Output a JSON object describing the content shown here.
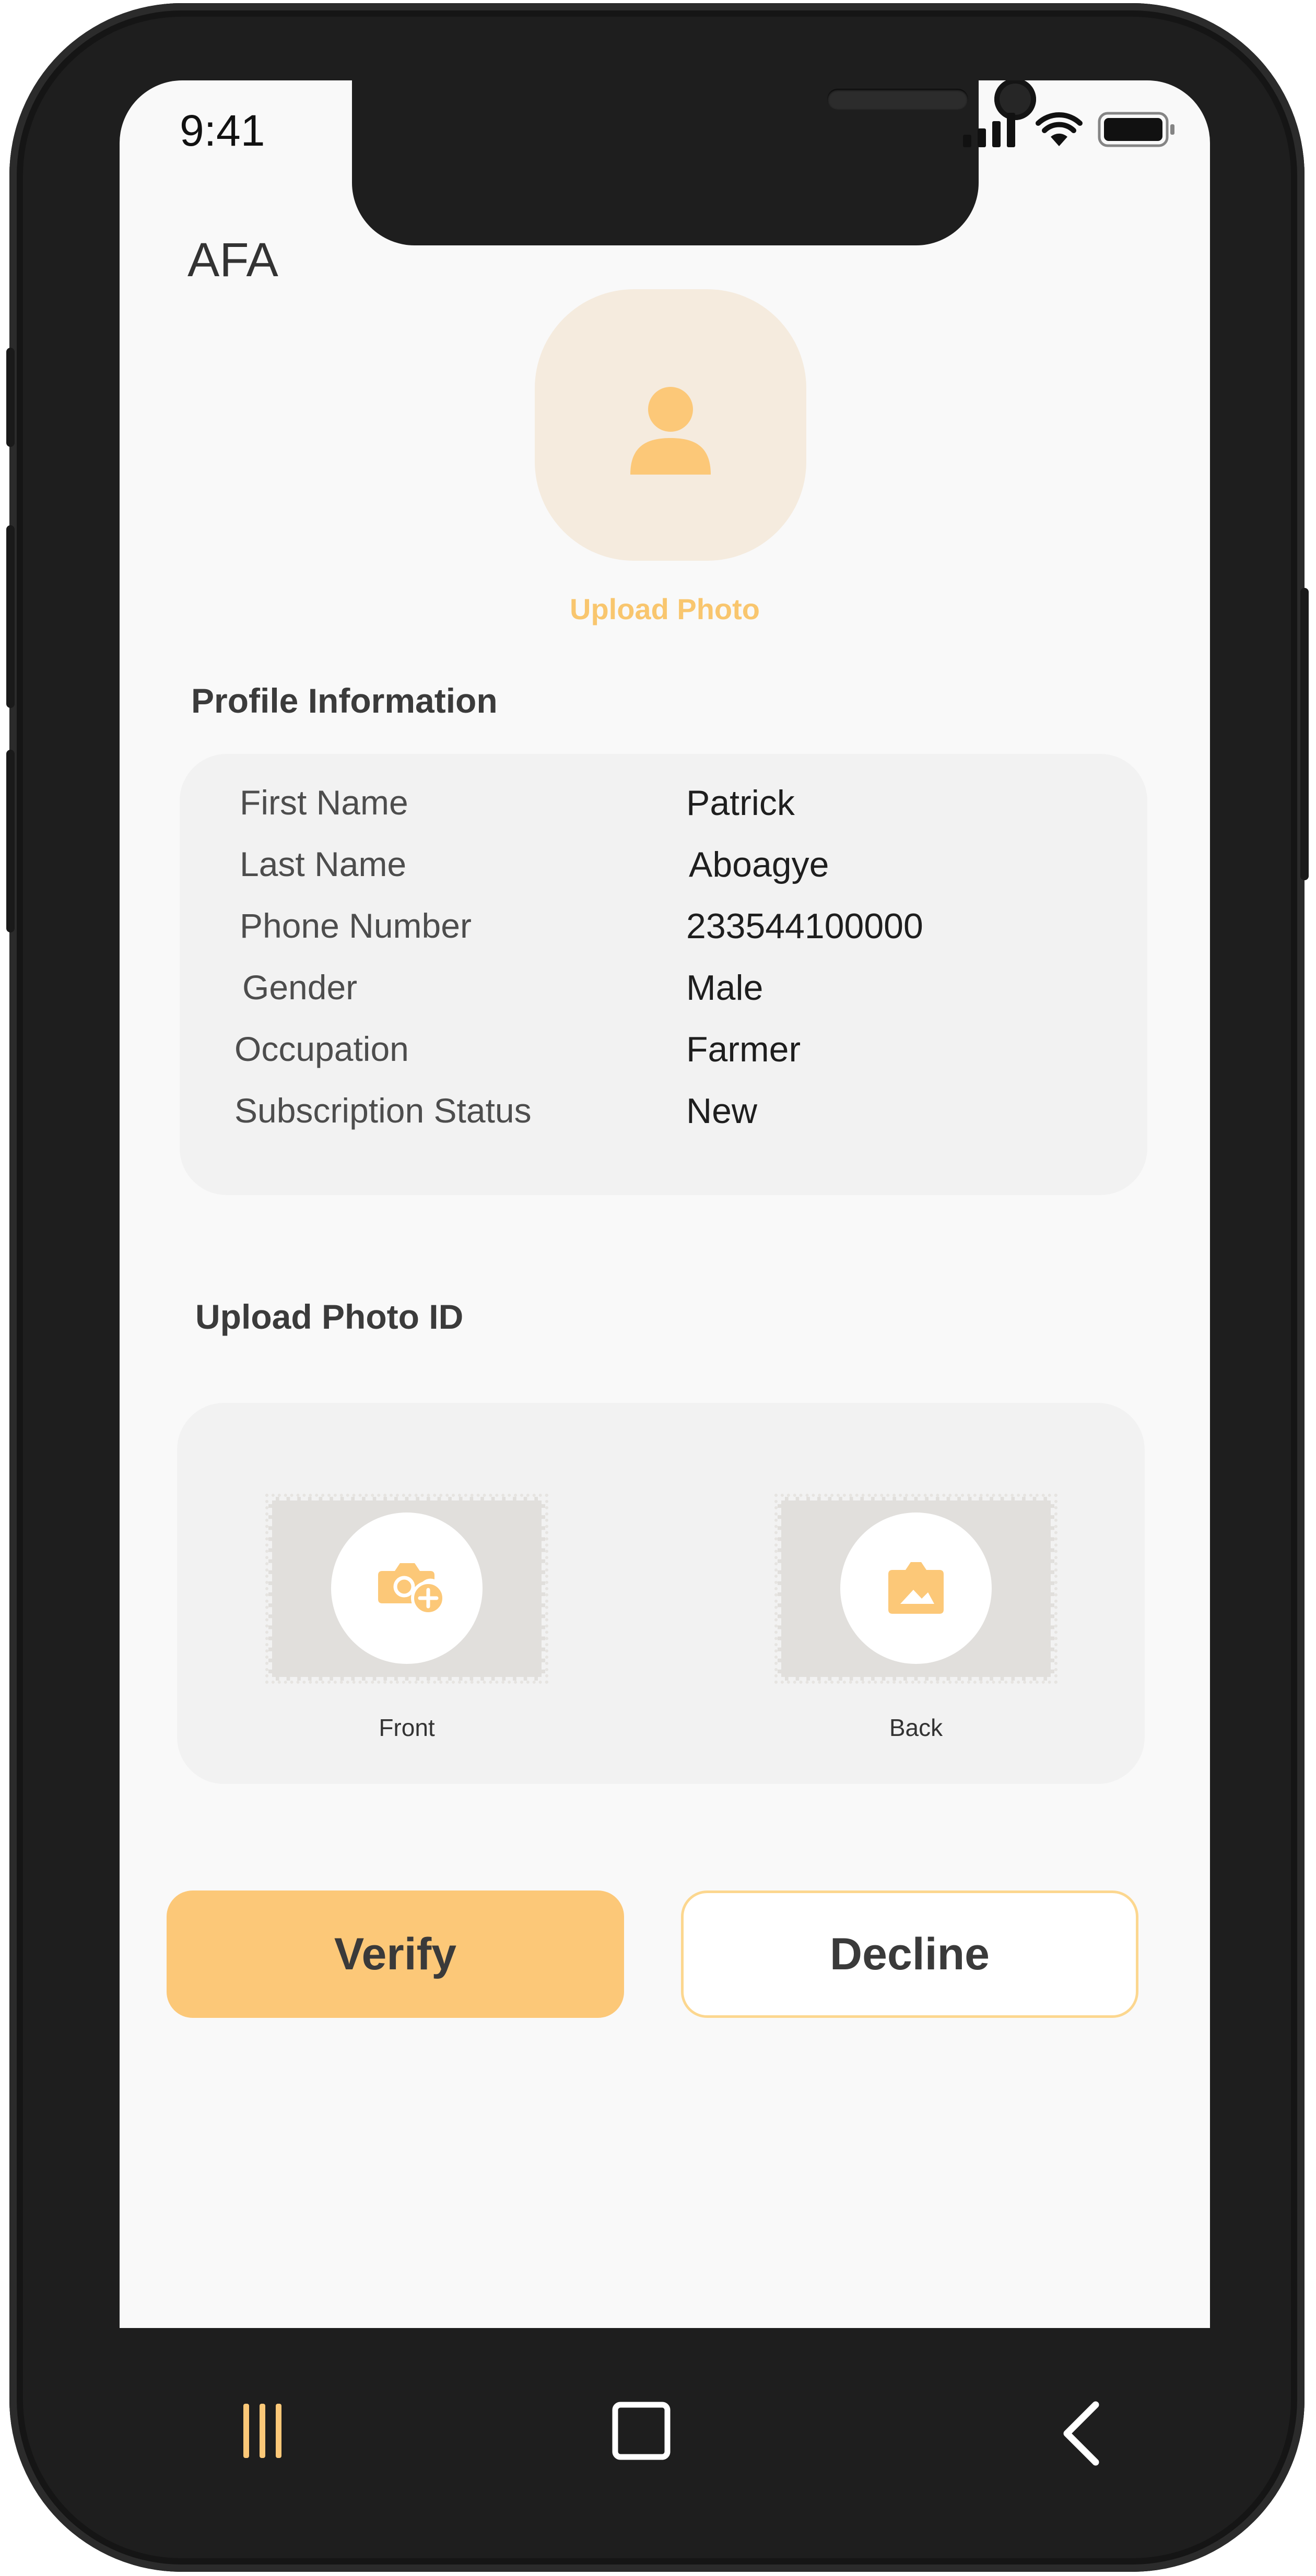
{
  "status_bar": {
    "time": "9:41"
  },
  "app": {
    "title": "AFA"
  },
  "profile_photo": {
    "upload_label": "Upload Photo"
  },
  "profile_information": {
    "title": "Profile Information",
    "rows": [
      {
        "label": "First Name",
        "value": "Patrick"
      },
      {
        "label": "Last Name",
        "value": "Aboagye"
      },
      {
        "label": "Phone Number",
        "value": "233544100000"
      },
      {
        "label": "Gender",
        "value": "Male"
      },
      {
        "label": "Occupation",
        "value": "Farmer"
      },
      {
        "label": "Subscription Status",
        "value": "New"
      }
    ]
  },
  "photo_id": {
    "title": "Upload Photo ID",
    "front_label": "Front",
    "back_label": "Back",
    "front_icon": "camera-add-icon",
    "back_icon": "image-icon"
  },
  "actions": {
    "verify_label": "Verify",
    "decline_label": "Decline"
  },
  "nav_bar": {
    "recent_icon": "recent-apps-icon",
    "home_icon": "home-icon",
    "back_icon": "back-icon"
  },
  "colors": {
    "accent": "#fcc878",
    "accent_text": "#f9c66e",
    "avatar_bg": "#f5ebde",
    "card_bg": "#f2f2f2"
  }
}
